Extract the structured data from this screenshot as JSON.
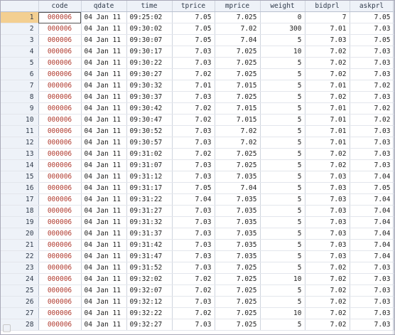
{
  "columns": [
    "code",
    "qdate",
    "time",
    "tprice",
    "mprice",
    "weight",
    "bidprl",
    "askprl"
  ],
  "rows": [
    {
      "n": "1",
      "code": "000006",
      "qdate": "04 Jan 11",
      "time": "09:25:02",
      "tprice": "7.05",
      "mprice": "7.025",
      "weight": "0",
      "bidprl": "7",
      "askprl": "7.05"
    },
    {
      "n": "2",
      "code": "000006",
      "qdate": "04 Jan 11",
      "time": "09:30:02",
      "tprice": "7.05",
      "mprice": "7.02",
      "weight": "300",
      "bidprl": "7.01",
      "askprl": "7.03"
    },
    {
      "n": "3",
      "code": "000006",
      "qdate": "04 Jan 11",
      "time": "09:30:07",
      "tprice": "7.05",
      "mprice": "7.04",
      "weight": "5",
      "bidprl": "7.03",
      "askprl": "7.05"
    },
    {
      "n": "4",
      "code": "000006",
      "qdate": "04 Jan 11",
      "time": "09:30:17",
      "tprice": "7.03",
      "mprice": "7.025",
      "weight": "10",
      "bidprl": "7.02",
      "askprl": "7.03"
    },
    {
      "n": "5",
      "code": "000006",
      "qdate": "04 Jan 11",
      "time": "09:30:22",
      "tprice": "7.03",
      "mprice": "7.025",
      "weight": "5",
      "bidprl": "7.02",
      "askprl": "7.03"
    },
    {
      "n": "6",
      "code": "000006",
      "qdate": "04 Jan 11",
      "time": "09:30:27",
      "tprice": "7.02",
      "mprice": "7.025",
      "weight": "5",
      "bidprl": "7.02",
      "askprl": "7.03"
    },
    {
      "n": "7",
      "code": "000006",
      "qdate": "04 Jan 11",
      "time": "09:30:32",
      "tprice": "7.01",
      "mprice": "7.015",
      "weight": "5",
      "bidprl": "7.01",
      "askprl": "7.02"
    },
    {
      "n": "8",
      "code": "000006",
      "qdate": "04 Jan 11",
      "time": "09:30:37",
      "tprice": "7.03",
      "mprice": "7.025",
      "weight": "5",
      "bidprl": "7.02",
      "askprl": "7.03"
    },
    {
      "n": "9",
      "code": "000006",
      "qdate": "04 Jan 11",
      "time": "09:30:42",
      "tprice": "7.02",
      "mprice": "7.015",
      "weight": "5",
      "bidprl": "7.01",
      "askprl": "7.02"
    },
    {
      "n": "10",
      "code": "000006",
      "qdate": "04 Jan 11",
      "time": "09:30:47",
      "tprice": "7.02",
      "mprice": "7.015",
      "weight": "5",
      "bidprl": "7.01",
      "askprl": "7.02"
    },
    {
      "n": "11",
      "code": "000006",
      "qdate": "04 Jan 11",
      "time": "09:30:52",
      "tprice": "7.03",
      "mprice": "7.02",
      "weight": "5",
      "bidprl": "7.01",
      "askprl": "7.03"
    },
    {
      "n": "12",
      "code": "000006",
      "qdate": "04 Jan 11",
      "time": "09:30:57",
      "tprice": "7.03",
      "mprice": "7.02",
      "weight": "5",
      "bidprl": "7.01",
      "askprl": "7.03"
    },
    {
      "n": "13",
      "code": "000006",
      "qdate": "04 Jan 11",
      "time": "09:31:02",
      "tprice": "7.02",
      "mprice": "7.025",
      "weight": "5",
      "bidprl": "7.02",
      "askprl": "7.03"
    },
    {
      "n": "14",
      "code": "000006",
      "qdate": "04 Jan 11",
      "time": "09:31:07",
      "tprice": "7.03",
      "mprice": "7.025",
      "weight": "5",
      "bidprl": "7.02",
      "askprl": "7.03"
    },
    {
      "n": "15",
      "code": "000006",
      "qdate": "04 Jan 11",
      "time": "09:31:12",
      "tprice": "7.03",
      "mprice": "7.035",
      "weight": "5",
      "bidprl": "7.03",
      "askprl": "7.04"
    },
    {
      "n": "16",
      "code": "000006",
      "qdate": "04 Jan 11",
      "time": "09:31:17",
      "tprice": "7.05",
      "mprice": "7.04",
      "weight": "5",
      "bidprl": "7.03",
      "askprl": "7.05"
    },
    {
      "n": "17",
      "code": "000006",
      "qdate": "04 Jan 11",
      "time": "09:31:22",
      "tprice": "7.04",
      "mprice": "7.035",
      "weight": "5",
      "bidprl": "7.03",
      "askprl": "7.04"
    },
    {
      "n": "18",
      "code": "000006",
      "qdate": "04 Jan 11",
      "time": "09:31:27",
      "tprice": "7.03",
      "mprice": "7.035",
      "weight": "5",
      "bidprl": "7.03",
      "askprl": "7.04"
    },
    {
      "n": "19",
      "code": "000006",
      "qdate": "04 Jan 11",
      "time": "09:31:32",
      "tprice": "7.03",
      "mprice": "7.035",
      "weight": "5",
      "bidprl": "7.03",
      "askprl": "7.04"
    },
    {
      "n": "20",
      "code": "000006",
      "qdate": "04 Jan 11",
      "time": "09:31:37",
      "tprice": "7.03",
      "mprice": "7.035",
      "weight": "5",
      "bidprl": "7.03",
      "askprl": "7.04"
    },
    {
      "n": "21",
      "code": "000006",
      "qdate": "04 Jan 11",
      "time": "09:31:42",
      "tprice": "7.03",
      "mprice": "7.035",
      "weight": "5",
      "bidprl": "7.03",
      "askprl": "7.04"
    },
    {
      "n": "22",
      "code": "000006",
      "qdate": "04 Jan 11",
      "time": "09:31:47",
      "tprice": "7.03",
      "mprice": "7.035",
      "weight": "5",
      "bidprl": "7.03",
      "askprl": "7.04"
    },
    {
      "n": "23",
      "code": "000006",
      "qdate": "04 Jan 11",
      "time": "09:31:52",
      "tprice": "7.03",
      "mprice": "7.025",
      "weight": "5",
      "bidprl": "7.02",
      "askprl": "7.03"
    },
    {
      "n": "24",
      "code": "000006",
      "qdate": "04 Jan 11",
      "time": "09:32:02",
      "tprice": "7.02",
      "mprice": "7.025",
      "weight": "10",
      "bidprl": "7.02",
      "askprl": "7.03"
    },
    {
      "n": "25",
      "code": "000006",
      "qdate": "04 Jan 11",
      "time": "09:32:07",
      "tprice": "7.02",
      "mprice": "7.025",
      "weight": "5",
      "bidprl": "7.02",
      "askprl": "7.03"
    },
    {
      "n": "26",
      "code": "000006",
      "qdate": "04 Jan 11",
      "time": "09:32:12",
      "tprice": "7.03",
      "mprice": "7.025",
      "weight": "5",
      "bidprl": "7.02",
      "askprl": "7.03"
    },
    {
      "n": "27",
      "code": "000006",
      "qdate": "04 Jan 11",
      "time": "09:32:22",
      "tprice": "7.02",
      "mprice": "7.025",
      "weight": "10",
      "bidprl": "7.02",
      "askprl": "7.03"
    },
    {
      "n": "28",
      "code": "000006",
      "qdate": "04 Jan 11",
      "time": "09:32:27",
      "tprice": "7.03",
      "mprice": "7.025",
      "weight": "5",
      "bidprl": "7.02",
      "askprl": "7.03"
    }
  ],
  "colors": {
    "code_text": "#b03a2e",
    "selected_row_number": "#f3cf91",
    "header_bg": "#eef2f8"
  }
}
